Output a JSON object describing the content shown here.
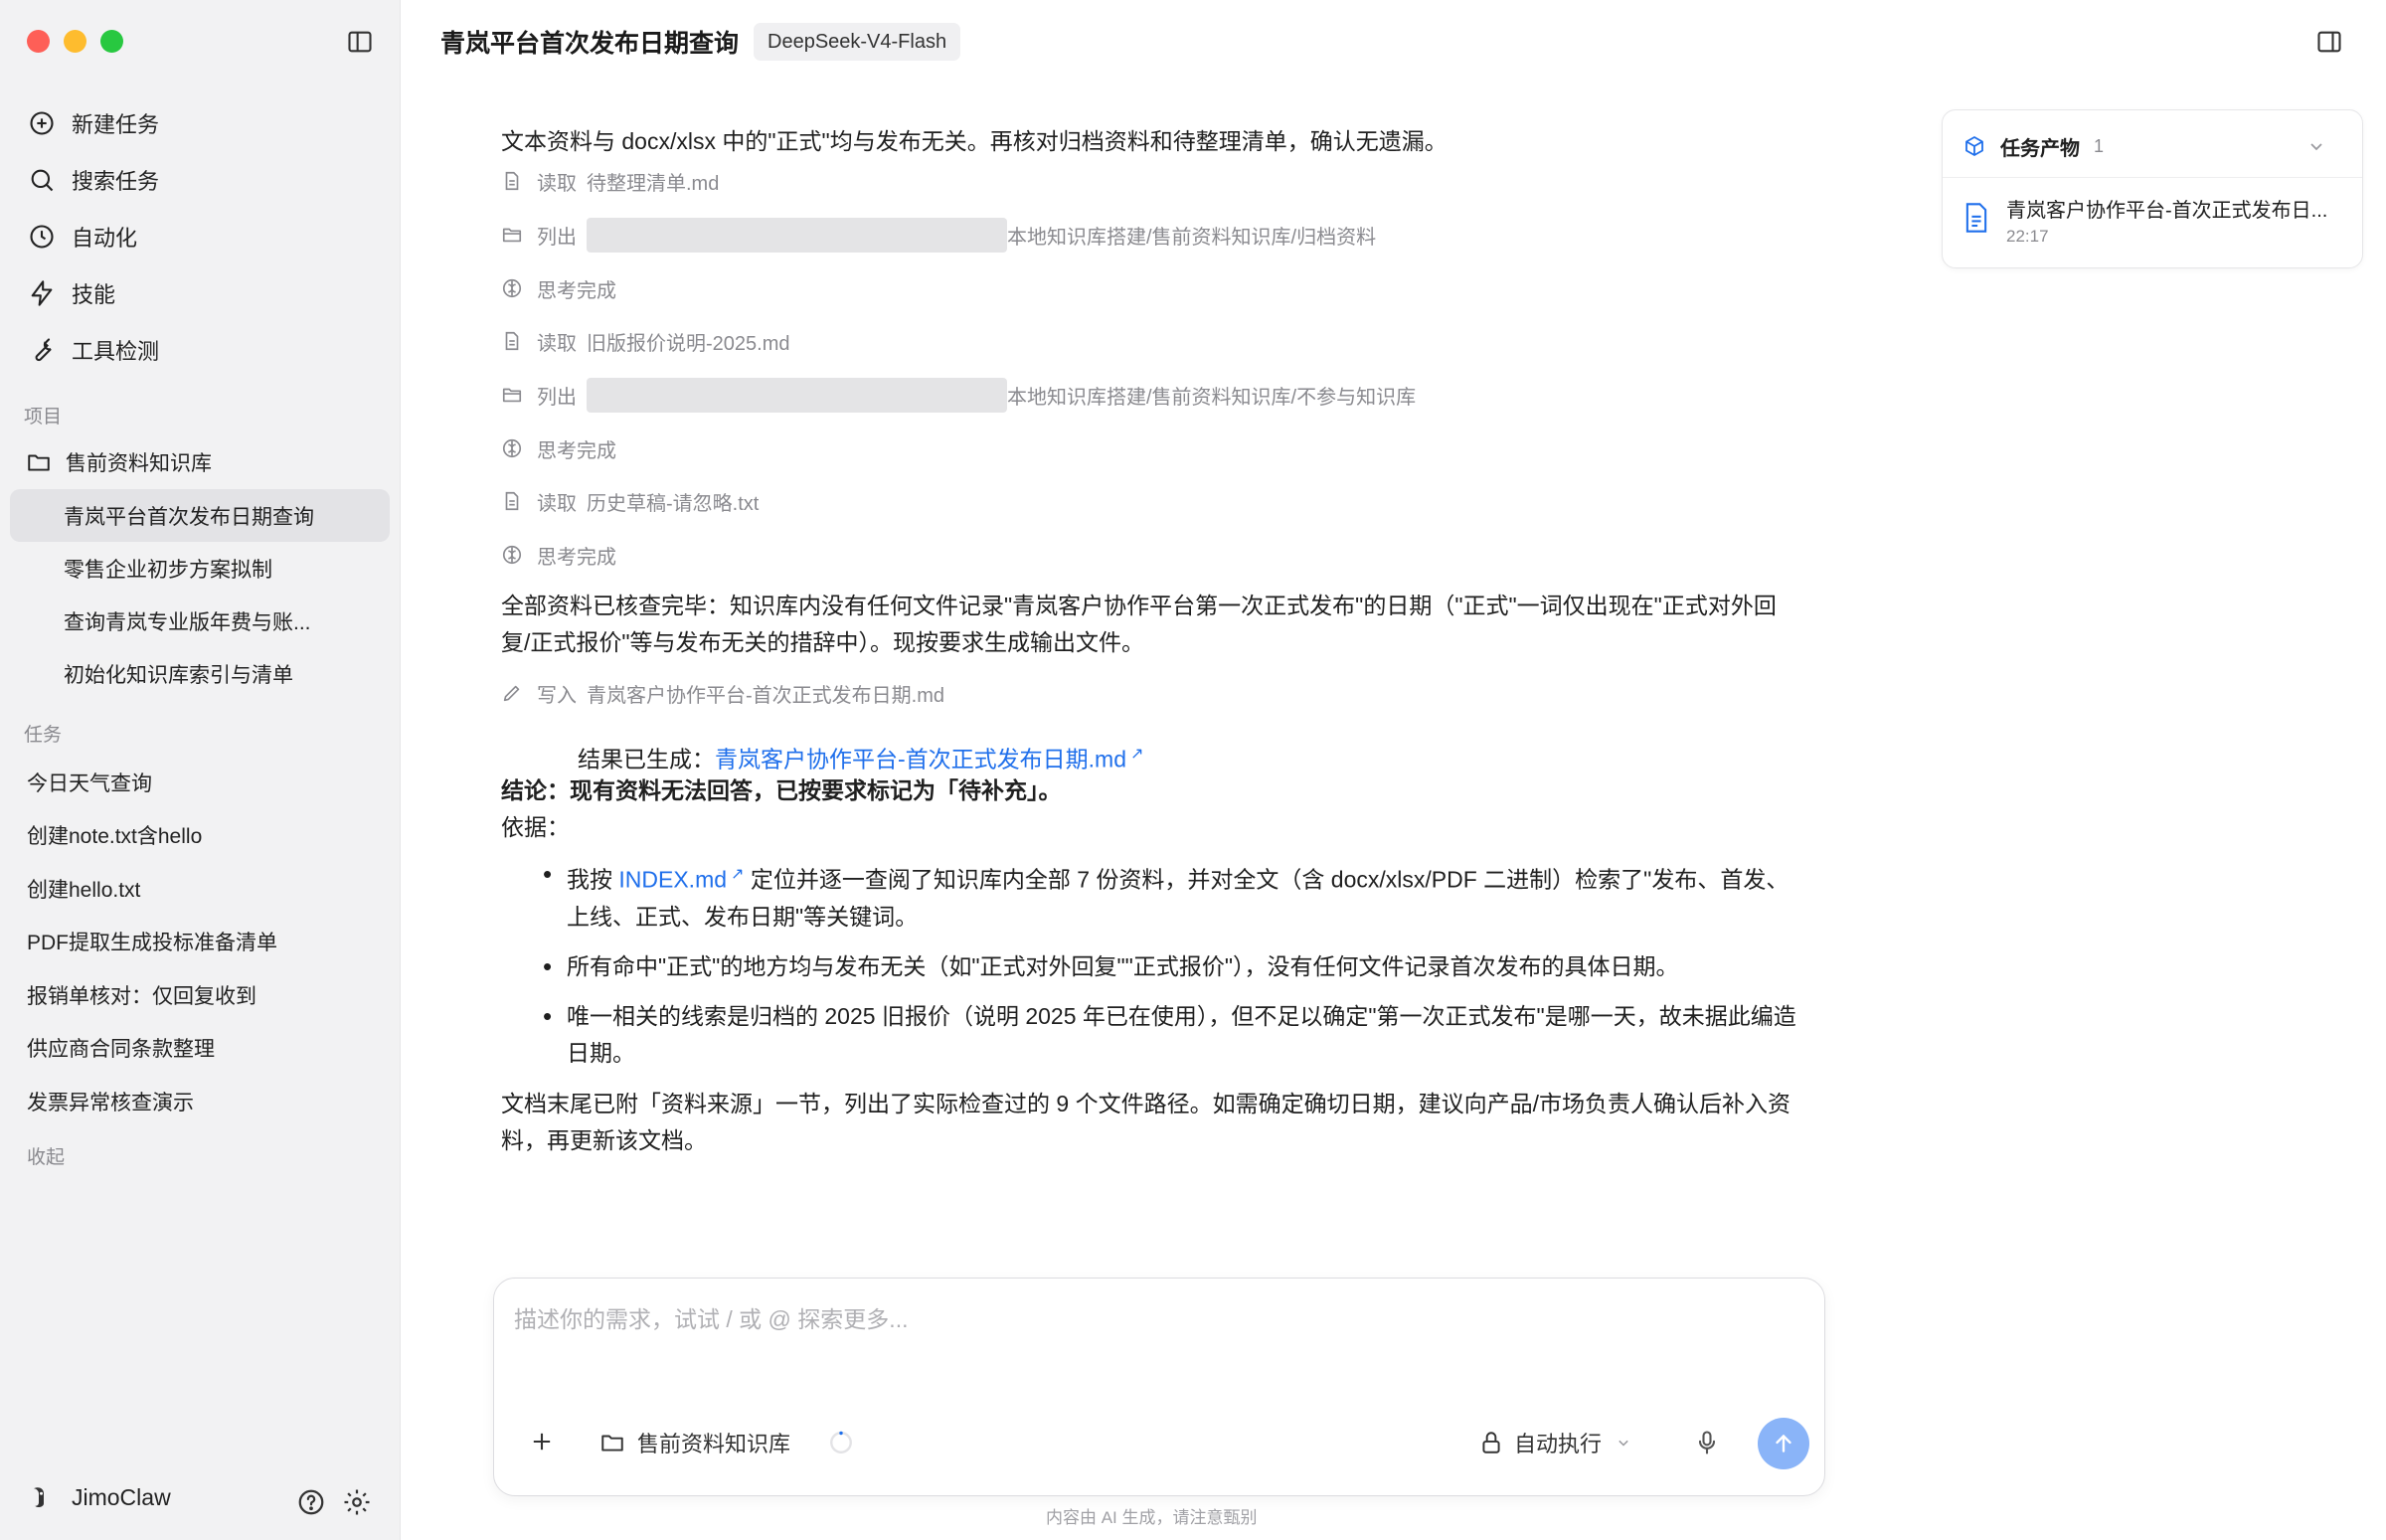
{
  "sidebar": {
    "nav": [
      {
        "label": "新建任务",
        "icon": "plus-circle-icon"
      },
      {
        "label": "搜索任务",
        "icon": "search-icon"
      },
      {
        "label": "自动化",
        "icon": "clock-icon"
      },
      {
        "label": "技能",
        "icon": "lightning-icon"
      },
      {
        "label": "工具检测",
        "icon": "wrench-icon"
      }
    ],
    "projects_label": "项目",
    "project_folder": "售前资料知识库",
    "project_items": [
      "青岚平台首次发布日期查询",
      "零售企业初步方案拟制",
      "查询青岚专业版年费与账...",
      "初始化知识库索引与清单"
    ],
    "tasks_label": "任务",
    "task_items": [
      "今日天气查询",
      "创建note.txt含hello",
      "创建hello.txt",
      "PDF提取生成投标准备清单",
      "报销单核对：仅回复收到",
      "供应商合同条款整理",
      "发票异常核查演示"
    ],
    "collapse_label": "收起",
    "user_name": "JimoClaw"
  },
  "header": {
    "title": "青岚平台首次发布日期查询",
    "model": "DeepSeek-V4-Flash"
  },
  "conversation": {
    "intro": "文本资料与 docx/xlsx 中的\"正式\"均与发布无关。再核对归档资料和待整理清单，确认无遗漏。",
    "steps": [
      {
        "verb": "读取",
        "target": "待整理清单.md",
        "icon": "file-icon"
      },
      {
        "verb": "列出",
        "target": "本地知识库搭建/售前资料知识库/归档资料",
        "icon": "folder-icon",
        "redacted": true
      },
      {
        "verb": "思考完成",
        "target": "",
        "icon": "brain-icon"
      },
      {
        "verb": "读取",
        "target": "旧版报价说明-2025.md",
        "icon": "file-icon"
      },
      {
        "verb": "列出",
        "target": "本地知识库搭建/售前资料知识库/不参与知识库",
        "icon": "folder-icon",
        "redacted": true
      },
      {
        "verb": "思考完成",
        "target": "",
        "icon": "brain-icon"
      },
      {
        "verb": "读取",
        "target": "历史草稿-请忽略.txt",
        "icon": "file-icon"
      },
      {
        "verb": "思考完成",
        "target": "",
        "icon": "brain-icon"
      }
    ],
    "summary": "全部资料已核查完毕：知识库内没有任何文件记录\"青岚客户协作平台第一次正式发布\"的日期（\"正式\"一词仅出现在\"正式对外回复/正式报价\"等与发布无关的措辞中）。现按要求生成输出文件。",
    "write_step": {
      "verb": "写入",
      "target": "青岚客户协作平台-首次正式发布日期.md"
    },
    "result_label": "结果已生成：",
    "result_link": "青岚客户协作平台-首次正式发布日期.md",
    "conclusion": "结论：现有资料无法回答，已按要求标记为「待补充」。",
    "basis_label": "依据：",
    "bullet1_prefix": "我按",
    "bullet1_link": "INDEX.md",
    "bullet1_rest": "定位并逐一查阅了知识库内全部 7 份资料，并对全文（含 docx/xlsx/PDF 二进制）检索了\"发布、首发、上线、正式、发布日期\"等关键词。",
    "bullet2": "所有命中\"正式\"的地方均与发布无关（如\"正式对外回复\"\"正式报价\"），没有任何文件记录首次发布的具体日期。",
    "bullet3": "唯一相关的线索是归档的 2025 旧报价（说明 2025 年已在使用），但不足以确定\"第一次正式发布\"是哪一天，故未据此编造日期。",
    "closing": "文档末尾已附「资料来源」一节，列出了实际检查过的 9 个文件路径。如需确定确切日期，建议向产品/市场负责人确认后补入资料，再更新该文档。"
  },
  "artifacts": {
    "title": "任务产物",
    "count": "1",
    "file_name": "青岚客户协作平台-首次正式发布日...",
    "file_time": "22:17"
  },
  "composer": {
    "placeholder": "描述你的需求，试试 / 或 @ 探索更多...",
    "kb_label": "售前资料知识库",
    "mode_label": "自动执行",
    "disclaimer": "内容由 AI 生成，请注意甄别"
  },
  "colors": {
    "accent": "#1f6feb",
    "send_button": "#8ab4f8",
    "sidebar_bg": "#f2f2f3"
  }
}
